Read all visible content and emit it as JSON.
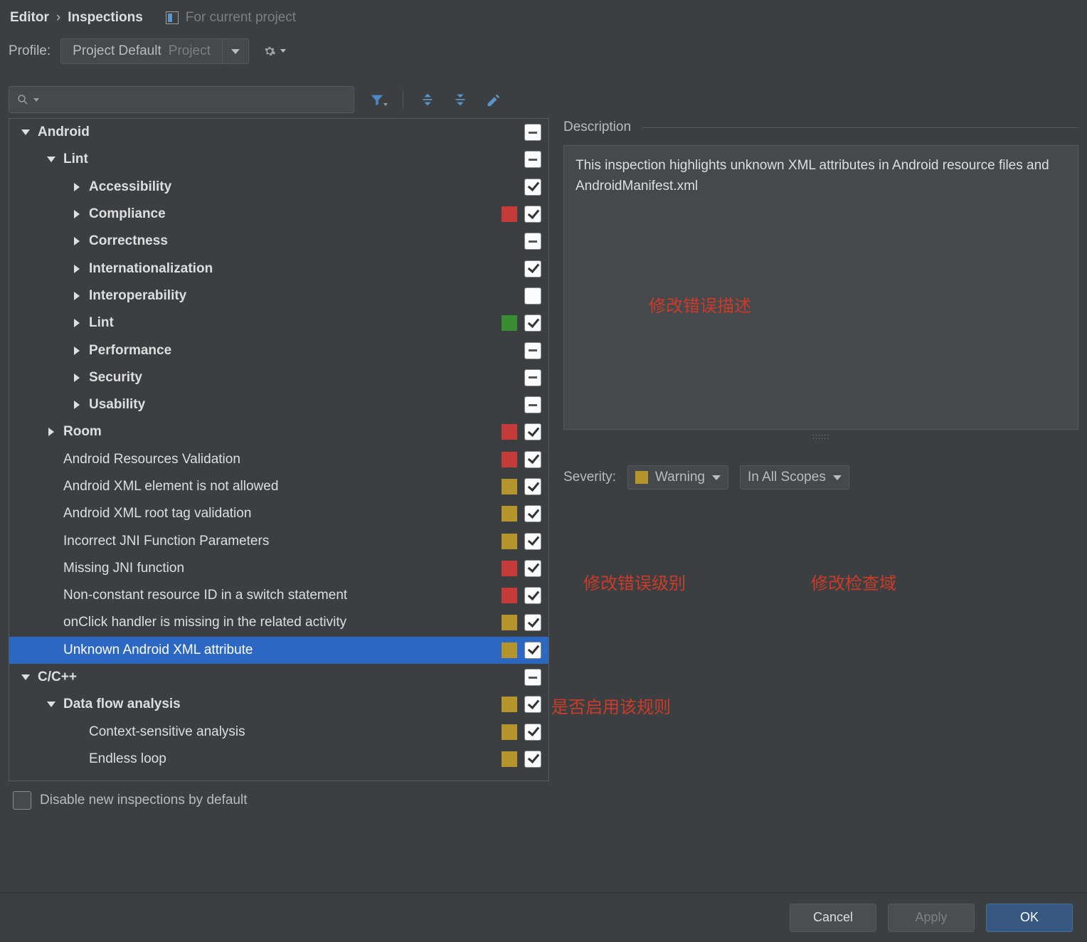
{
  "breadcrumb": {
    "editor": "Editor",
    "inspections": "Inspections",
    "scope": "For current project"
  },
  "profile": {
    "label": "Profile:",
    "name": "Project Default",
    "tag": "Project"
  },
  "search": {
    "placeholder": ""
  },
  "tree": [
    {
      "depth": 0,
      "disc": "down",
      "bold": true,
      "label": "Android",
      "state": "mixed"
    },
    {
      "depth": 1,
      "disc": "down",
      "bold": true,
      "label": "Lint",
      "state": "mixed"
    },
    {
      "depth": 2,
      "disc": "right",
      "bold": true,
      "label": "Accessibility",
      "state": "on"
    },
    {
      "depth": 2,
      "disc": "right",
      "bold": true,
      "label": "Compliance",
      "swatch": "red",
      "state": "on"
    },
    {
      "depth": 2,
      "disc": "right",
      "bold": true,
      "label": "Correctness",
      "state": "mixed"
    },
    {
      "depth": 2,
      "disc": "right",
      "bold": true,
      "label": "Internationalization",
      "state": "on"
    },
    {
      "depth": 2,
      "disc": "right",
      "bold": true,
      "label": "Interoperability",
      "state": "off"
    },
    {
      "depth": 2,
      "disc": "right",
      "bold": true,
      "label": "Lint",
      "swatch": "green",
      "state": "on"
    },
    {
      "depth": 2,
      "disc": "right",
      "bold": true,
      "label": "Performance",
      "state": "mixed"
    },
    {
      "depth": 2,
      "disc": "right",
      "bold": true,
      "label": "Security",
      "state": "mixed"
    },
    {
      "depth": 2,
      "disc": "right",
      "bold": true,
      "label": "Usability",
      "state": "mixed"
    },
    {
      "depth": 1,
      "disc": "right",
      "bold": true,
      "label": "Room",
      "swatch": "red",
      "state": "on"
    },
    {
      "depth": 1,
      "disc": "none",
      "label": "Android Resources Validation",
      "swatch": "red",
      "state": "on"
    },
    {
      "depth": 1,
      "disc": "none",
      "label": "Android XML element is not allowed",
      "swatch": "yellow",
      "state": "on"
    },
    {
      "depth": 1,
      "disc": "none",
      "label": "Android XML root tag validation",
      "swatch": "yellow",
      "state": "on"
    },
    {
      "depth": 1,
      "disc": "none",
      "label": "Incorrect JNI Function Parameters",
      "swatch": "yellow",
      "state": "on"
    },
    {
      "depth": 1,
      "disc": "none",
      "label": "Missing JNI function",
      "swatch": "red",
      "state": "on"
    },
    {
      "depth": 1,
      "disc": "none",
      "label": "Non-constant resource ID in a switch statement",
      "swatch": "red",
      "state": "on"
    },
    {
      "depth": 1,
      "disc": "none",
      "label": "onClick handler is missing in the related activity",
      "swatch": "yellow",
      "state": "on"
    },
    {
      "depth": 1,
      "disc": "none",
      "label": "Unknown Android XML attribute",
      "swatch": "yellow",
      "state": "on",
      "selected": true
    },
    {
      "depth": 0,
      "disc": "down",
      "bold": true,
      "label": "C/C++",
      "state": "mixed"
    },
    {
      "depth": 1,
      "disc": "down",
      "bold": true,
      "label": "Data flow analysis",
      "swatch": "yellow",
      "state": "on"
    },
    {
      "depth": 2,
      "disc": "none",
      "label": "Context-sensitive analysis",
      "swatch": "yellow",
      "state": "on"
    },
    {
      "depth": 2,
      "disc": "none",
      "label": "Endless loop",
      "swatch": "yellow",
      "state": "on"
    }
  ],
  "disable_new": "Disable new inspections by default",
  "description": {
    "title": "Description",
    "text": "This inspection highlights unknown XML attributes in Android resource files and AndroidManifest.xml"
  },
  "severity": {
    "label": "Severity:",
    "value": "Warning",
    "scope": "In All Scopes"
  },
  "annotations": {
    "desc": "修改错误描述",
    "level": "修改错误级别",
    "scope": "修改检查域",
    "enable": "是否启用该规则"
  },
  "buttons": {
    "cancel": "Cancel",
    "apply": "Apply",
    "ok": "OK"
  }
}
